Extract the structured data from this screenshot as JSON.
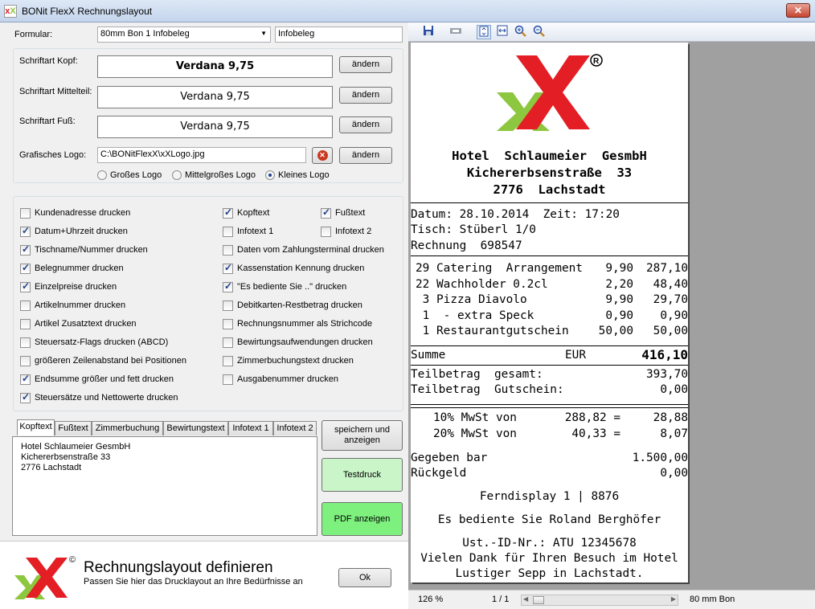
{
  "window": {
    "title": "BONit FlexX Rechnungslayout",
    "close": "✕",
    "icon": "app-icon"
  },
  "form": {
    "formular_label": "Formular:",
    "formular_value": "80mm Bon 1   Infobeleg",
    "formular_name": "Infobeleg",
    "font_head_label": "Schriftart Kopf:",
    "font_head_value": "Verdana 9,75",
    "font_mid_label": "Schriftart Mittelteil:",
    "font_mid_value": "Verdana 9,75",
    "font_foot_label": "Schriftart Fuß:",
    "font_foot_value": "Verdana 9,75",
    "change_label": "ändern",
    "logo_label": "Grafisches Logo:",
    "logo_path": "C:\\BONitFlexX\\xXLogo.jpg",
    "logo_sizes": [
      "Großes Logo",
      "Mittelgroßes Logo",
      "Kleines Logo"
    ],
    "logo_size_selected": 2
  },
  "options_left": [
    {
      "label": "Kundenadresse drucken",
      "checked": false
    },
    {
      "label": "Datum+Uhrzeit drucken",
      "checked": true
    },
    {
      "label": "Tischname/Nummer drucken",
      "checked": true
    },
    {
      "label": "Belegnummer drucken",
      "checked": true
    },
    {
      "label": "Einzelpreise drucken",
      "checked": true
    },
    {
      "label": "Artikelnummer drucken",
      "checked": false
    },
    {
      "label": "Artikel Zusatztext drucken",
      "checked": false
    },
    {
      "label": "Steuersatz-Flags drucken (ABCD)",
      "checked": false
    },
    {
      "label": "größeren Zeilenabstand bei Positionen",
      "checked": false
    },
    {
      "label": "Endsumme größer und fett drucken",
      "checked": true
    },
    {
      "label": "Steuersätze und Nettowerte drucken",
      "checked": true
    }
  ],
  "options_right": [
    {
      "label": "Kopftext",
      "checked": true
    },
    {
      "label": "Infotext 1",
      "checked": false
    },
    {
      "label": "Daten vom Zahlungsterminal drucken",
      "checked": false
    },
    {
      "label": "Kassenstation Kennung drucken",
      "checked": true
    },
    {
      "label": "\"Es bediente Sie ..\" drucken",
      "checked": true
    },
    {
      "label": "Debitkarten-Restbetrag drucken",
      "checked": false
    },
    {
      "label": "Rechnungsnummer als Strichcode",
      "checked": false
    },
    {
      "label": "Bewirtungsaufwendungen drucken",
      "checked": false
    },
    {
      "label": "Zimmerbuchungstext drucken",
      "checked": false
    },
    {
      "label": "Ausgabenummer drucken",
      "checked": false
    }
  ],
  "options_far": [
    {
      "label": "Fußtext",
      "checked": true
    },
    {
      "label": "Infotext 2",
      "checked": false
    }
  ],
  "tabs": [
    "Kopftext",
    "Fußtext",
    "Zimmerbuchung",
    "Bewirtungstext",
    "Infotext 1",
    "Infotext 2"
  ],
  "active_tab": 0,
  "tab_content": "Hotel Schlaumeier GesmbH\nKichererbsenstraße 33\n2776 Lachstadt",
  "actions": {
    "save": "speichern und\nanzeigen",
    "testprint": "Testdruck",
    "pdf": "PDF anzeigen",
    "ok": "Ok"
  },
  "footer": {
    "title": "Rechnungslayout definieren",
    "subtitle": "Passen Sie hier das Drucklayout an Ihre Bedürfnisse an"
  },
  "preview": {
    "toolbar_icons": [
      "save-icon",
      "print-icon",
      "fit-page-icon",
      "fit-width-icon",
      "zoom-in-icon",
      "zoom-out-icon"
    ],
    "header": [
      "Hotel  Schlaumeier  GesmbH",
      "Kichererbsenstraße  33",
      "2776  Lachstadt"
    ],
    "info": [
      "Datum: 28.10.2014  Zeit: 17:20",
      "Tisch: Stüberl 1/0",
      "Rechnung  698547"
    ],
    "items": [
      {
        "qty": "29",
        "name": "Catering  Arrangement",
        "price": "9,90",
        "total": "287,10"
      },
      {
        "qty": "22",
        "name": "Wachholder 0.2cl",
        "price": "2,20",
        "total": "48,40"
      },
      {
        "qty": " 3",
        "name": "Pizza Diavolo",
        "price": "9,90",
        "total": "29,70"
      },
      {
        "qty": " 1",
        "name": " - extra Speck",
        "price": "0,90",
        "total": "0,90"
      },
      {
        "qty": " 1",
        "name": "Restaurantgutschein",
        "price": "50,00",
        "total": "50,00"
      }
    ],
    "sum_label": "Summe",
    "sum_currency": "EUR",
    "sum_value": "416,10",
    "partial_total_label": "Teilbetrag  gesamt:",
    "partial_total_value": "393,70",
    "partial_voucher_label": "Teilbetrag  Gutschein:",
    "partial_voucher_value": "0,00",
    "taxes": [
      {
        "label": "10% MwSt von",
        "base": "288,82 =",
        "value": "28,88"
      },
      {
        "label": "20% MwSt von",
        "base": "40,33 =",
        "value": "8,07"
      }
    ],
    "given_label": "Gegeben bar",
    "given_value": "1.500,00",
    "change_label": "Rückgeld",
    "change_value": "0,00",
    "display_line": "Ferndisplay 1 | 8876",
    "served_line": "Es bediente Sie Roland Berghöfer",
    "footer_lines": [
      "Ust.-ID-Nr.: ATU 12345678",
      "Vielen Dank für Ihren Besuch im Hotel",
      "Lustiger Sepp in Lachstadt."
    ],
    "status_zoom": "126 %",
    "status_page": "1 / 1",
    "status_format": "80 mm Bon"
  },
  "colors": {
    "logo_red": "#e31e24",
    "logo_green": "#8dc63f",
    "test_btn": "#c9f5c9",
    "pdf_btn": "#7ef07e"
  }
}
